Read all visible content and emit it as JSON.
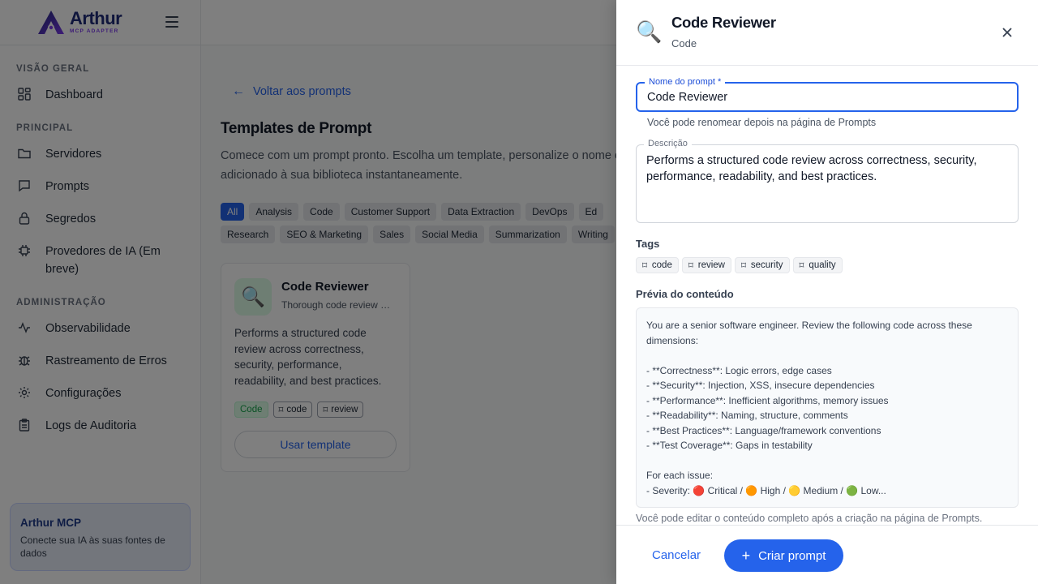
{
  "brand": {
    "name": "Arthur",
    "sub": "MCP ADAPTER"
  },
  "sidebar": {
    "sections": [
      {
        "title": "VISÃO GERAL",
        "items": [
          {
            "label": "Dashboard",
            "icon": "grid-icon"
          }
        ]
      },
      {
        "title": "PRINCIPAL",
        "items": [
          {
            "label": "Servidores",
            "icon": "folder-icon"
          },
          {
            "label": "Prompts",
            "icon": "chat-icon"
          },
          {
            "label": "Segredos",
            "icon": "lock-icon"
          },
          {
            "label": "Provedores de IA (Em breve)",
            "icon": "chip-icon"
          }
        ]
      },
      {
        "title": "ADMINISTRAÇÃO",
        "items": [
          {
            "label": "Observabilidade",
            "icon": "pulse-icon"
          },
          {
            "label": "Rastreamento de Erros",
            "icon": "bug-icon"
          },
          {
            "label": "Configurações",
            "icon": "gear-icon"
          },
          {
            "label": "Logs de Auditoria",
            "icon": "clipboard-icon"
          }
        ]
      }
    ],
    "promo": {
      "title": "Arthur MCP",
      "text": "Conecte sua IA às suas fontes de dados"
    }
  },
  "main": {
    "back_label": "Voltar aos prompts",
    "title": "Templates de Prompt",
    "description": "Comece com um prompt pronto. Escolha um template, personalize o nome e adicionado à sua biblioteca instantaneamente.",
    "categories": [
      "All",
      "Analysis",
      "Code",
      "Customer Support",
      "Data Extraction",
      "DevOps",
      "Ed",
      "Research",
      "SEO & Marketing",
      "Sales",
      "Social Media",
      "Summarization",
      "Writing"
    ],
    "card": {
      "icon": "🔍",
      "title": "Code Reviewer",
      "subtitle": "Thorough code review across",
      "description": "Performs a structured code review across correctness, security, performance, readability, and best practices.",
      "category": "Code",
      "tags": [
        "code",
        "review"
      ],
      "button": "Usar template"
    }
  },
  "drawer": {
    "icon": "🔍",
    "title": "Code Reviewer",
    "subtitle": "Code",
    "name_label": "Nome do prompt *",
    "name_value": "Code Reviewer",
    "name_helper": "Você pode renomear depois na página de Prompts",
    "desc_label": "Descrição",
    "desc_value": "Performs a structured code review across correctness, security, performance, readability, and best practices.",
    "tags_label": "Tags",
    "tags": [
      "code",
      "review",
      "security",
      "quality"
    ],
    "preview_label": "Prévia do conteúdo",
    "preview_text": "You are a senior software engineer. Review the following code across these dimensions:\n\n- **Correctness**: Logic errors, edge cases\n- **Security**: Injection, XSS, insecure dependencies\n- **Performance**: Inefficient algorithms, memory issues\n- **Readability**: Naming, structure, comments\n- **Best Practices**: Language/framework conventions\n- **Test Coverage**: Gaps in testability\n\nFor each issue:\n- Severity: 🔴 Critical / 🟠 High / 🟡 Medium / 🟢 Low...",
    "preview_helper": "Você pode editar o conteúdo completo após a criação na página de Prompts.",
    "cancel": "Cancelar",
    "create": "Criar prompt"
  },
  "colors": {
    "accent": "#2563eb",
    "brand": "#1e2a78"
  }
}
